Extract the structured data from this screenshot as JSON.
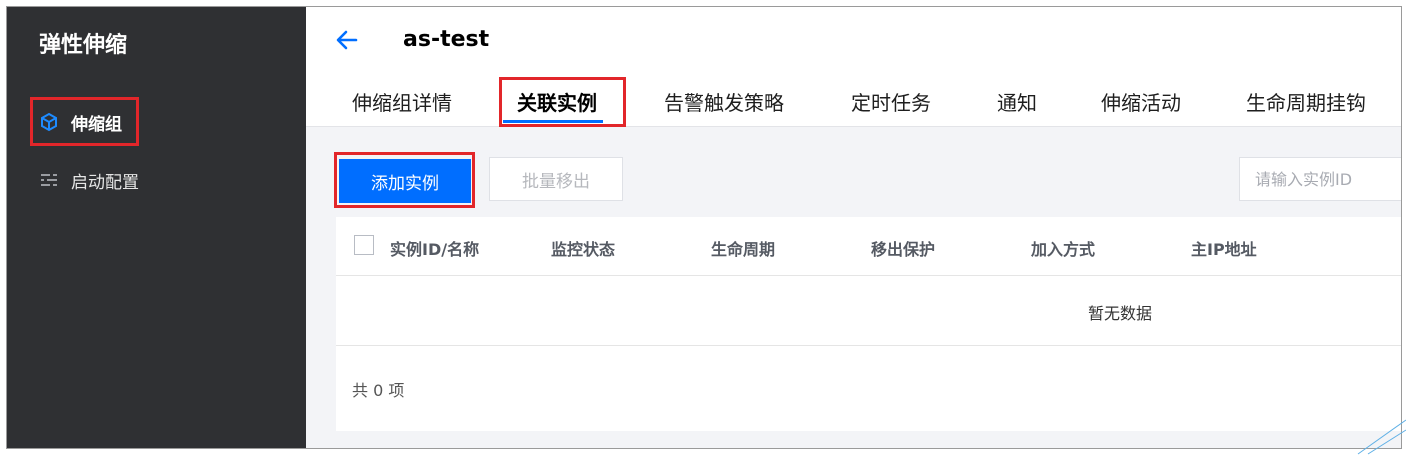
{
  "sidebar": {
    "title": "弹性伸缩",
    "items": [
      {
        "label": "伸缩组",
        "icon": "cube-icon",
        "active": true
      },
      {
        "label": "启动配置",
        "icon": "sliders-icon",
        "active": false
      }
    ]
  },
  "header": {
    "back_icon": "arrow-left-icon",
    "title": "as-test"
  },
  "tabs": [
    {
      "label": "伸缩组详情"
    },
    {
      "label": "关联实例",
      "active": true
    },
    {
      "label": "告警触发策略"
    },
    {
      "label": "定时任务"
    },
    {
      "label": "通知"
    },
    {
      "label": "伸缩活动"
    },
    {
      "label": "生命周期挂钩"
    }
  ],
  "toolbar": {
    "add_label": "添加实例",
    "batch_remove_label": "批量移出",
    "search_placeholder": "请输入实例ID"
  },
  "table": {
    "columns": [
      "实例ID/名称",
      "监控状态",
      "生命周期",
      "移出保护",
      "加入方式",
      "主IP地址"
    ],
    "empty_text": "暂无数据",
    "footer_total": "共 0 项"
  },
  "colors": {
    "accent": "#006eff",
    "sidebar_bg": "#2f3033",
    "highlight": "#e2262a"
  }
}
